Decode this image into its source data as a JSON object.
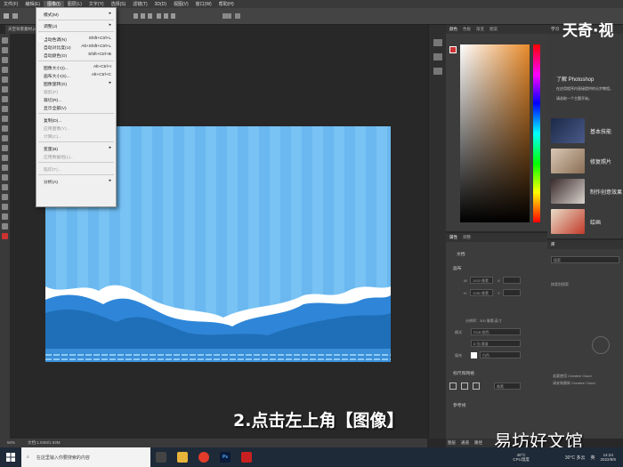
{
  "menubar": {
    "items": [
      "文件(F)",
      "编辑(E)",
      "图像(I)",
      "图层(L)",
      "文字(Y)",
      "选择(S)",
      "滤镜(T)",
      "3D(D)",
      "视图(V)",
      "窗口(W)",
      "帮助(H)"
    ]
  },
  "document": {
    "tab": "天空背景素材.psd @ 50%",
    "zoom": "50%",
    "doc_size": "文档:1.93M/1.93M"
  },
  "image_menu": {
    "items": [
      {
        "label": "模式(M)",
        "shortcut": "▸",
        "disabled": false
      },
      {
        "label": "调整(J)",
        "shortcut": "▸",
        "disabled": false
      },
      {
        "label": "自动色调(N)",
        "shortcut": "Shift+Ctrl+L",
        "disabled": false
      },
      {
        "label": "自动对比度(U)",
        "shortcut": "Alt+Shift+Ctrl+L",
        "disabled": false
      },
      {
        "label": "自动颜色(O)",
        "shortcut": "Shift+Ctrl+B",
        "disabled": false
      },
      {
        "label": "图像大小(I)...",
        "shortcut": "Alt+Ctrl+I",
        "disabled": false
      },
      {
        "label": "画布大小(S)...",
        "shortcut": "Alt+Ctrl+C",
        "disabled": false
      },
      {
        "label": "图像旋转(G)",
        "shortcut": "▸",
        "disabled": false
      },
      {
        "label": "裁剪(P)",
        "shortcut": "",
        "disabled": true
      },
      {
        "label": "裁切(R)...",
        "shortcut": "",
        "disabled": false
      },
      {
        "label": "显示全部(V)",
        "shortcut": "",
        "disabled": false
      },
      {
        "label": "复制(D)...",
        "shortcut": "",
        "disabled": false
      },
      {
        "label": "应用图像(Y)...",
        "shortcut": "",
        "disabled": true
      },
      {
        "label": "计算(C)...",
        "shortcut": "",
        "disabled": true
      },
      {
        "label": "变量(B)",
        "shortcut": "▸",
        "disabled": false
      },
      {
        "label": "应用数据组(L)...",
        "shortcut": "",
        "disabled": true
      },
      {
        "label": "陷印(T)...",
        "shortcut": "",
        "disabled": true
      },
      {
        "label": "分析(A)",
        "shortcut": "▸",
        "disabled": false
      }
    ]
  },
  "color_panel": {
    "tabs": [
      "颜色",
      "色板",
      "渐变",
      "图案"
    ]
  },
  "properties_panel": {
    "tabs": [
      "属性",
      "调整"
    ],
    "doc_label": "文档",
    "canvas_label": "画布",
    "width_label": "W",
    "width_value": "1920 像素",
    "height_label": "H",
    "height_value": "1080 像素",
    "x_label": "X",
    "y_label": "Y",
    "resolution": "分辨率：300 像素/英寸",
    "mode_label": "模式",
    "mode_value": "RGB 颜色",
    "depth_value": "8 位/通道",
    "fill_label": "填充",
    "fill_value": "白色",
    "guides_label": "标尺和网格",
    "guides_unit": "像素",
    "guides2_label": "参考线"
  },
  "learn_panel": {
    "tab": "学习",
    "title": "了解 Photoshop",
    "desc1": "在应用程序内直接提供的分步教程。",
    "desc2": "请选取一个主题开始。",
    "topics": [
      "基本技能",
      "修复照片",
      "制作创意效果",
      "绘画"
    ]
  },
  "layers_panel": {
    "tab": "库",
    "search_label": "搜索",
    "placeholder": "按类别搜索",
    "cc_text1": "若要使用 Creative Cloud",
    "cc_text2": "请安装最新 Creative Cloud"
  },
  "bottom_tabs": [
    "图层",
    "通道",
    "路径"
  ],
  "caption": "2.点击左上角【图像】",
  "watermark_top": "天奇·视",
  "watermark_bottom": "易坊好文馆",
  "taskbar": {
    "search_placeholder": "在这里输入你要搜索的内容",
    "weather": "46°C",
    "cpu_label": "CPU温度",
    "temp": "30°C 多云",
    "ime": "英",
    "time": "14:24",
    "date": "2022/8/5"
  },
  "colors": {
    "accent": "#2f7fd0",
    "menu_bg": "#f0f0f0",
    "sky_light": "#78c2f4",
    "sky_dark": "#1f6fb8"
  }
}
